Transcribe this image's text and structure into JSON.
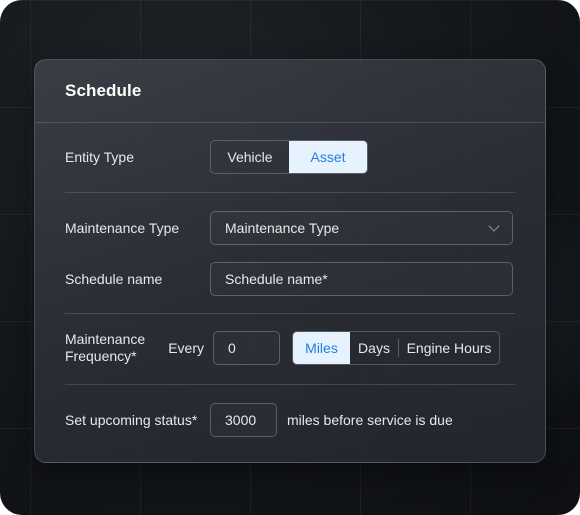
{
  "card": {
    "title": "Schedule"
  },
  "entity_type": {
    "label": "Entity Type",
    "options": [
      "Vehicle",
      "Asset"
    ],
    "selected": "Asset"
  },
  "maintenance_type": {
    "label": "Maintenance Type",
    "value": "Maintenance Type"
  },
  "schedule_name": {
    "label": "Schedule name",
    "value": "Schedule name*"
  },
  "frequency": {
    "label": "Maintenance Frequency*",
    "every_label": "Every",
    "value": "0",
    "units": [
      "Miles",
      "Days",
      "Engine Hours"
    ],
    "selected_unit": "Miles"
  },
  "upcoming": {
    "label": "Set upcoming status*",
    "value": "3000",
    "suffix": "miles before service is due"
  },
  "colors": {
    "accent": "#1f7fe0",
    "accent_bg": "#e6f3ff",
    "card_bg": "#2e3138"
  },
  "icons": {
    "dropdown": "chevron-down-icon"
  }
}
